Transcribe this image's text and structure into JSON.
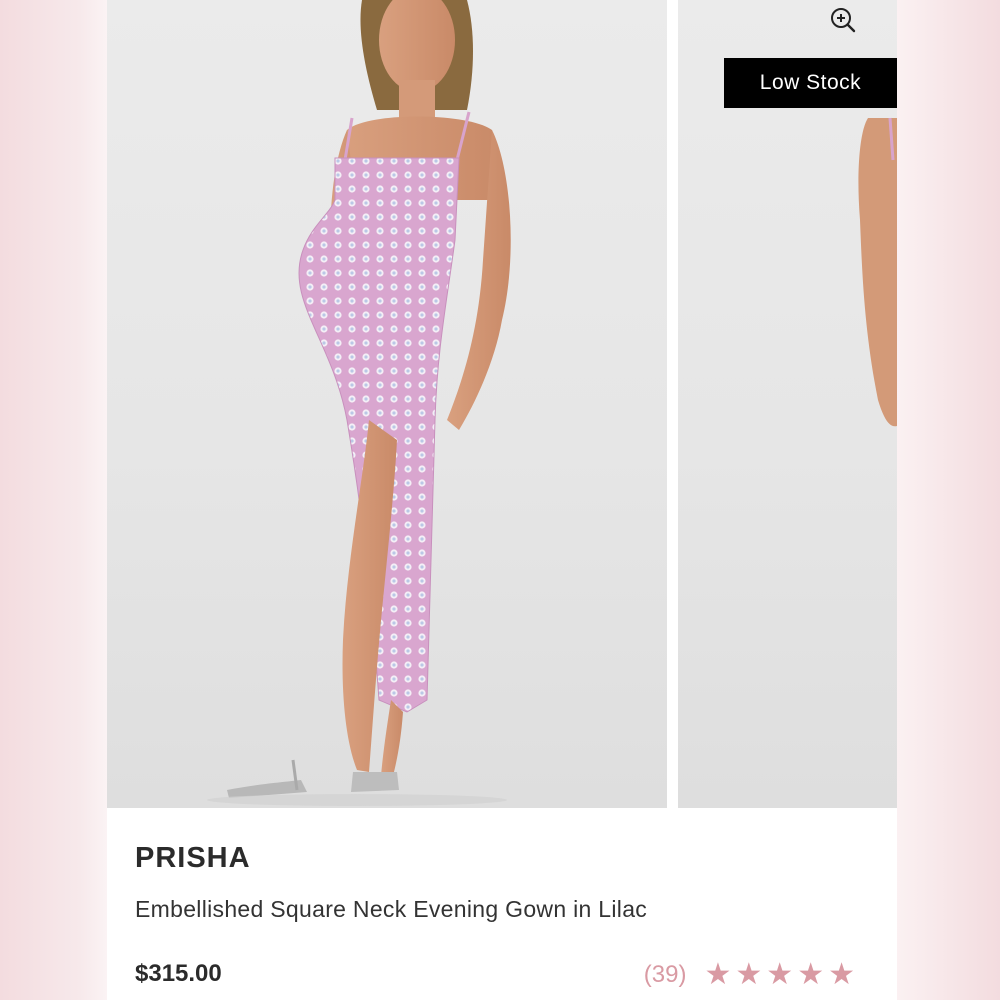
{
  "product": {
    "badge": "Low Stock",
    "brand": "PRISHA",
    "title": "Embellished Square Neck Evening Gown in Lilac",
    "price": "$315.00",
    "review_count": "(39)",
    "rating": 5,
    "rating_max": 5
  },
  "icons": {
    "zoom": "zoom-in-icon",
    "star": "star-icon"
  },
  "colors": {
    "accent": "#d99aa3",
    "badge_bg": "#000000",
    "dress": "#d8a3cc"
  }
}
